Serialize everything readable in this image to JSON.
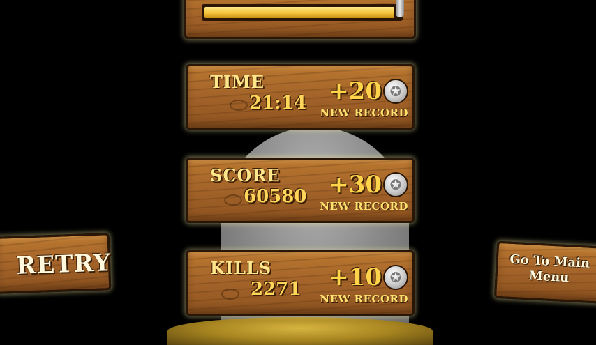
{
  "progress": {
    "fraction": 0.97
  },
  "stats": [
    {
      "label": "TIME",
      "value": "21:14",
      "bonus": "+20",
      "record": "NEW RECORD"
    },
    {
      "label": "SCORE",
      "value": "60580",
      "bonus": "+30",
      "record": "NEW RECORD"
    },
    {
      "label": "KILLS",
      "value": "2271",
      "bonus": "+10",
      "record": "NEW RECORD"
    }
  ],
  "buttons": {
    "retry": "RETRY",
    "main_menu_line1": "Go To Main",
    "main_menu_line2": "Menu"
  },
  "icons": {
    "coin": "sheriff-star-coin-icon"
  },
  "colors": {
    "wood": "#a5652a",
    "text_gold": "#ffd65a",
    "bar_fill": "#f3c23a",
    "background": "#000000"
  }
}
